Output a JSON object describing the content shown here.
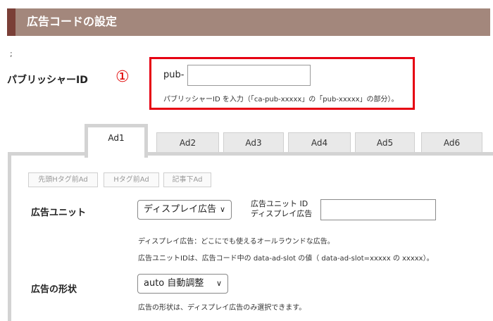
{
  "header": {
    "title": "広告コードの設定"
  },
  "misc": {
    "semicolon": ";"
  },
  "publisher": {
    "label": "パブリッシャーID",
    "marker": "①",
    "prefix": "pub-",
    "value": "",
    "help": "パブリッシャーID を入力（「ca-pub-xxxxx」の「pub-xxxxx」の部分）。"
  },
  "tabs": [
    {
      "label": "Ad1",
      "active": true
    },
    {
      "label": "Ad2"
    },
    {
      "label": "Ad3"
    },
    {
      "label": "Ad4"
    },
    {
      "label": "Ad5"
    },
    {
      "label": "Ad6"
    }
  ],
  "sub_buttons": [
    "先頭Hタグ前Ad",
    "Hタグ前Ad",
    "記事下Ad"
  ],
  "ad_unit": {
    "label": "広告ユニット",
    "select_value": "ディスプレイ広告",
    "id_label_line1": "広告ユニット ID",
    "id_label_line2": "ディスプレイ広告",
    "id_value": "",
    "help1": "ディスプレイ広告：どこにでも使えるオールラウンドな広告。",
    "help2": "広告ユニットIDは、広告コード中の data-ad-slot の値（ data-ad-slot=xxxxx の xxxxx）。"
  },
  "ad_format": {
    "label": "広告の形状",
    "select_value": "auto 自動調整",
    "help": "広告の形状は、ディスプレイ広告のみ選択できます。"
  },
  "colors": {
    "header_bg": "#a3877c",
    "header_accent": "#7a3f37",
    "highlight_red": "#e60012"
  }
}
